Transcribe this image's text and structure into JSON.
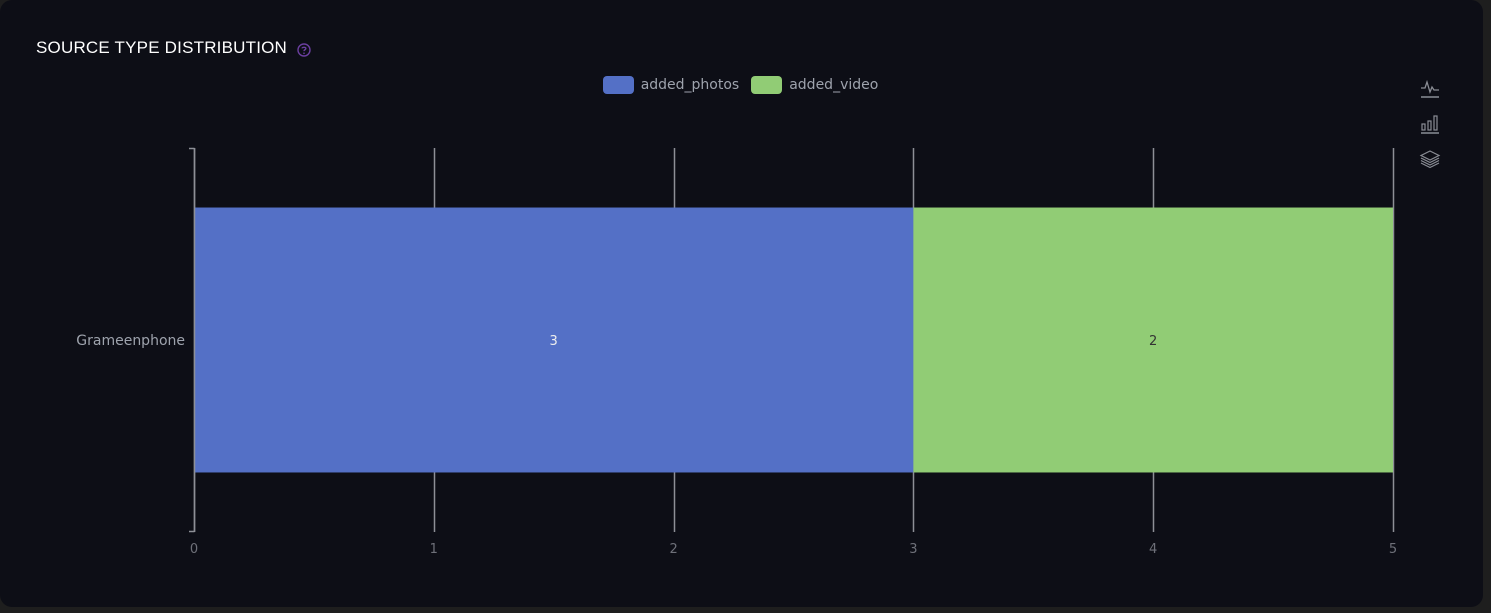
{
  "panel": {
    "title": "SOURCE TYPE DISTRIBUTION",
    "help_icon": "question-circle-icon"
  },
  "colors": {
    "accent_help": "#6b3fa0",
    "series_photos": "#5470c6",
    "series_video": "#91cc75",
    "axis": "#6e7079",
    "label_text": "#9ea3ad"
  },
  "toolbox": {
    "items": [
      {
        "icon": "line-chart-icon",
        "label": "Switch to line chart"
      },
      {
        "icon": "bar-chart-icon",
        "label": "Switch to bar chart"
      },
      {
        "icon": "stack-icon",
        "label": "Stack"
      }
    ]
  },
  "chart_data": {
    "type": "bar",
    "orientation": "horizontal",
    "stacked": true,
    "title": "SOURCE TYPE DISTRIBUTION",
    "categories": [
      "Grameenphone"
    ],
    "series": [
      {
        "name": "added_photos",
        "values": [
          3
        ],
        "color": "#5470c6",
        "label_color": "#eeeeee"
      },
      {
        "name": "added_video",
        "values": [
          2
        ],
        "color": "#91cc75",
        "label_color": "#333333"
      }
    ],
    "xlabel": "",
    "ylabel": "",
    "xlim": [
      0,
      5
    ],
    "x_ticks": [
      "0",
      "1",
      "2",
      "3",
      "4",
      "5"
    ],
    "grid": true,
    "legend_position": "top-center",
    "data_labels": true
  }
}
